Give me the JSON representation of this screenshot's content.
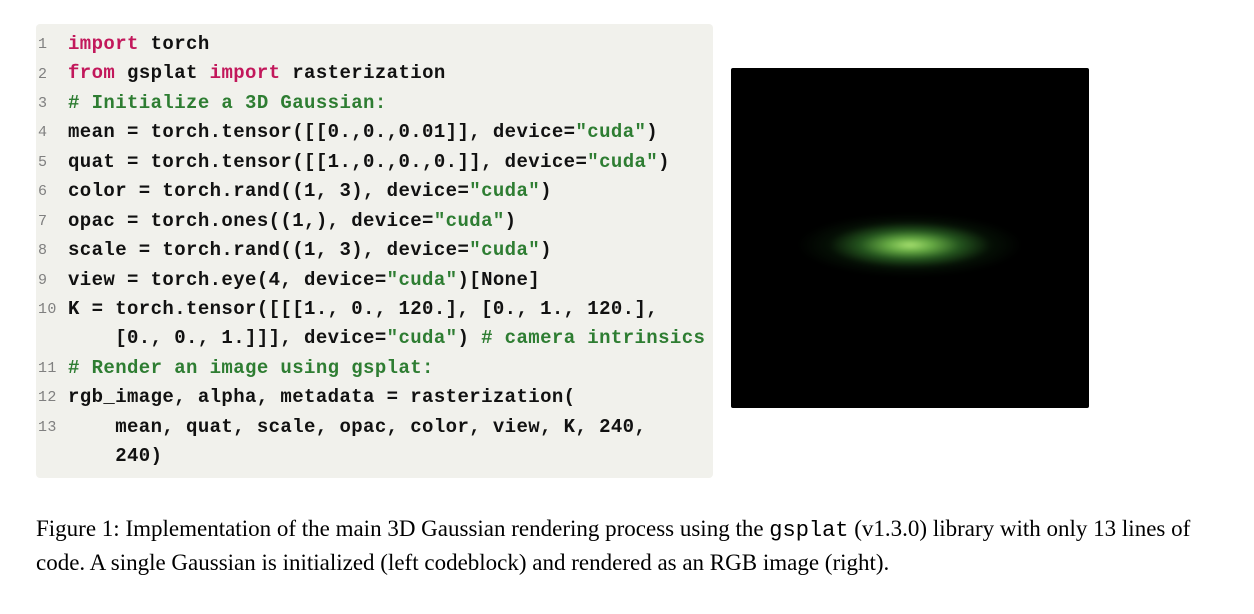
{
  "code": {
    "lines": [
      {
        "n": "1",
        "html": "<span class='kw'>import</span> torch"
      },
      {
        "n": "2",
        "html": "<span class='kw'>from</span> gsplat <span class='kw'>import</span> rasterization"
      },
      {
        "n": "3",
        "html": "<span class='cmt'># Initialize a 3D Gaussian:</span>"
      },
      {
        "n": "4",
        "html": "mean = torch.tensor([[0.,0.,0.01]], device=<span class='str'>\"cuda\"</span>)"
      },
      {
        "n": "5",
        "html": "quat = torch.tensor([[1.,0.,0.,0.]], device=<span class='str'>\"cuda\"</span>)"
      },
      {
        "n": "6",
        "html": "color = torch.rand((1, 3), device=<span class='str'>\"cuda\"</span>)"
      },
      {
        "n": "7",
        "html": "opac = torch.ones((1,), device=<span class='str'>\"cuda\"</span>)"
      },
      {
        "n": "8",
        "html": "scale = torch.rand((1, 3), device=<span class='str'>\"cuda\"</span>)"
      },
      {
        "n": "9",
        "html": "view = torch.eye(4, device=<span class='str'>\"cuda\"</span>)[None]"
      },
      {
        "n": "10",
        "html": "K = torch.tensor([[[1., 0., 120.], [0., 1., 120.],\n    [0., 0., 1.]]], device=<span class='str'>\"cuda\"</span>) <span class='cmt'># camera intrinsics</span>"
      },
      {
        "n": "11",
        "html": "<span class='cmt'># Render an image using gsplat:</span>"
      },
      {
        "n": "12",
        "html": "rgb_image, alpha, metadata = rasterization("
      },
      {
        "n": "13",
        "html": "    mean, quat, scale, opac, color, view, K, 240,\n    240)"
      }
    ]
  },
  "caption": {
    "label": "Figure 1:",
    "text_before_mono": "  Implementation of the main 3D Gaussian rendering process using the ",
    "mono_word": "gsplat",
    "text_after_mono": " (v1.3.0) library with only 13 lines of code. A single Gaussian is initialized (left codeblock) and rendered as an RGB image (right)."
  }
}
